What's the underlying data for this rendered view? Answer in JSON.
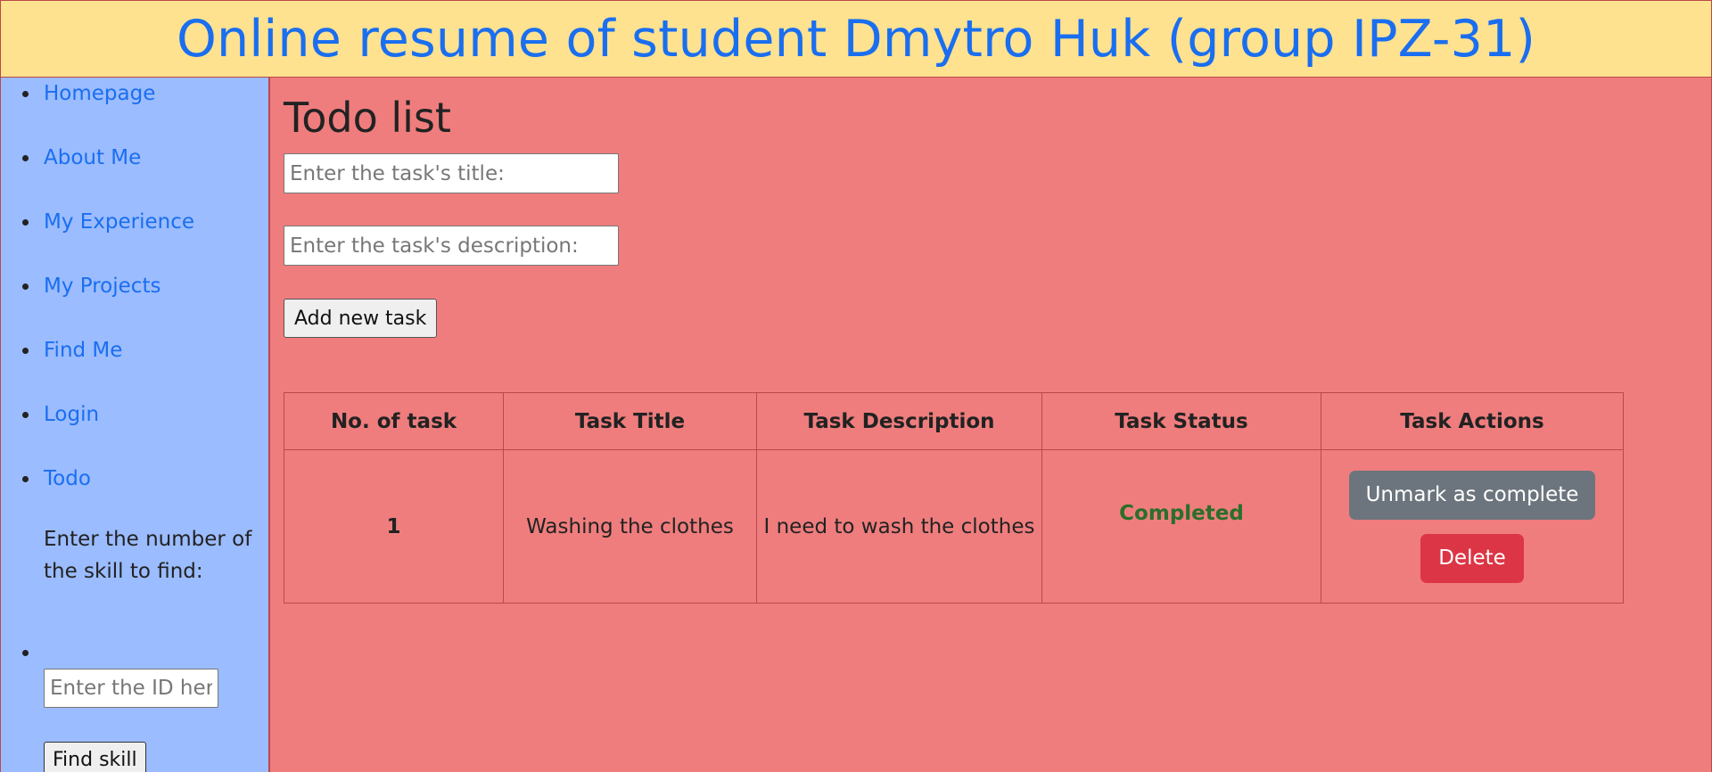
{
  "header": {
    "title": "Online resume of student Dmytro Huk (group IPZ-31)"
  },
  "sidebar": {
    "items": [
      {
        "label": "Homepage"
      },
      {
        "label": "About Me"
      },
      {
        "label": "My Experience"
      },
      {
        "label": "My Projects"
      },
      {
        "label": "Find Me"
      },
      {
        "label": "Login"
      },
      {
        "label": "Todo"
      }
    ],
    "skill_finder": {
      "label": "Enter the number of the skill to find:",
      "placeholder": "Enter the ID here",
      "value": "",
      "button_label": "Find skill"
    }
  },
  "main": {
    "title": "Todo list",
    "title_input": {
      "placeholder": "Enter the task's title:",
      "value": ""
    },
    "description_input": {
      "placeholder": "Enter the task's description:",
      "value": ""
    },
    "add_button_label": "Add new task",
    "table": {
      "headers": [
        "No. of task",
        "Task Title",
        "Task Description",
        "Task Status",
        "Task Actions"
      ],
      "rows": [
        {
          "number": "1",
          "title": "Washing the clothes",
          "description": "I need to wash the clothes",
          "status": "Completed",
          "unmark_label": "Unmark as complete",
          "delete_label": "Delete"
        }
      ]
    }
  },
  "colors": {
    "header_bg": "#fee28f",
    "title_color": "#1a6ef0",
    "sidebar_bg": "#9bbcfe",
    "main_bg": "#ef7d7d",
    "border": "#b94a4a",
    "status_completed": "#2a6f2a",
    "unmark_button": "#6c757d",
    "delete_button": "#dc3545"
  }
}
